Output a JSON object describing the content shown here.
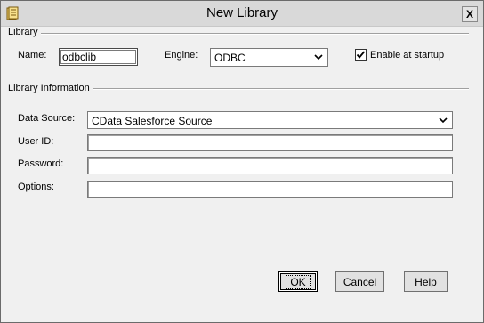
{
  "window": {
    "title": "New Library",
    "icon": "library-book-icon",
    "close_label": "X"
  },
  "library_group": {
    "label": "Library",
    "name_label": "Name:",
    "name_value": "odbclib",
    "engine_label": "Engine:",
    "engine_value": "ODBC",
    "enable_label": "Enable at startup",
    "enable_checked": true
  },
  "info_group": {
    "label": "Library Information",
    "datasource_label": "Data Source:",
    "datasource_value": "CData Salesforce Source",
    "userid_label": "User ID:",
    "userid_value": "",
    "password_label": "Password:",
    "password_value": "",
    "options_label": "Options:",
    "options_value": ""
  },
  "buttons": {
    "ok_label": "OK",
    "cancel_label": "Cancel",
    "help_label": "Help"
  }
}
